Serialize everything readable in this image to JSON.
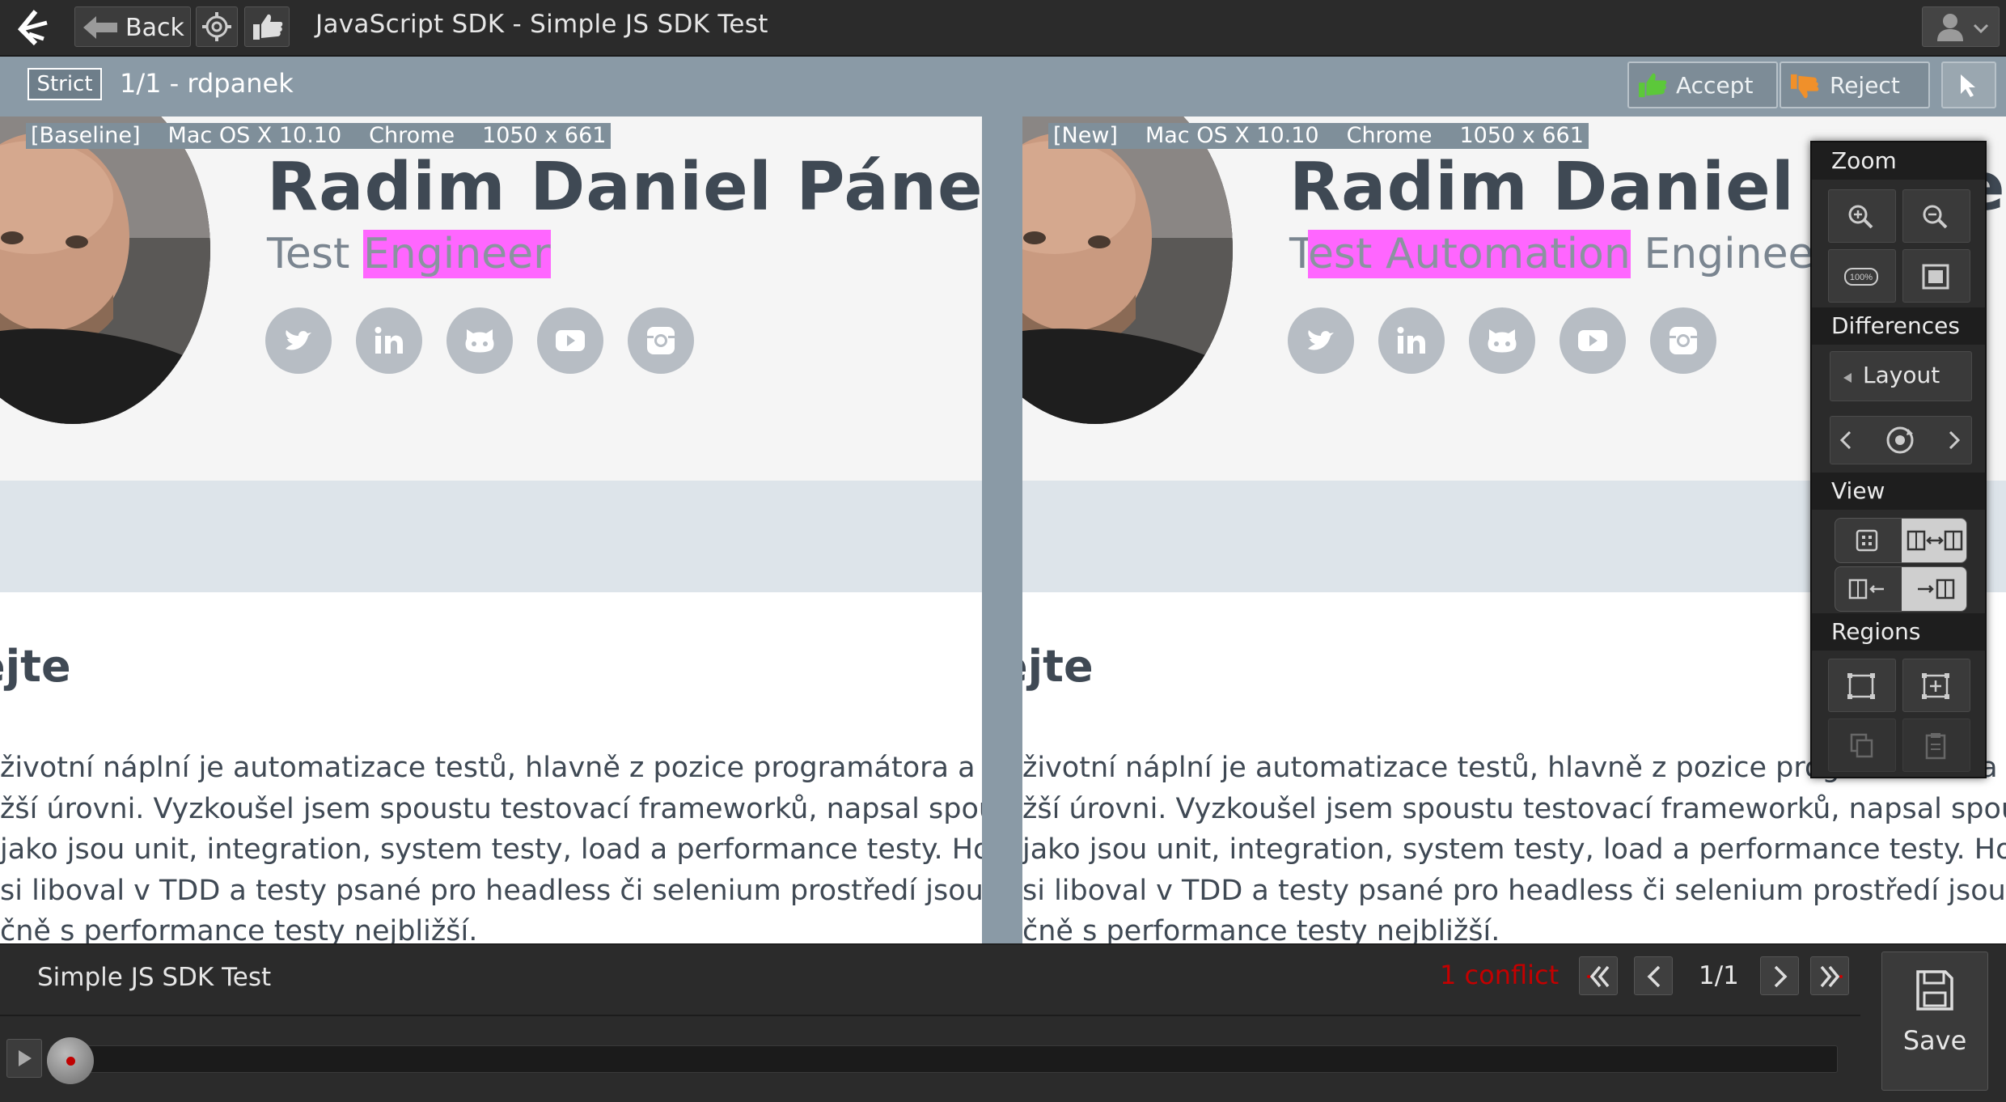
{
  "topbar": {
    "back_label": "Back",
    "title": "JavaScript SDK - Simple JS SDK Test",
    "icons": [
      "applitools-logo-icon",
      "back-arrow-icon",
      "gear-icon",
      "thumbs-up-icon",
      "user-icon",
      "chevron-down-icon"
    ]
  },
  "subbar": {
    "strict_label": "Strict",
    "step_info": "1/1  -  rdpanek",
    "accept_label": "Accept",
    "reject_label": "Reject"
  },
  "baseline": {
    "tag": "[Baseline]",
    "os": "Mac OS X 10.10",
    "browser": "Chrome",
    "viewport": "1050 x 661",
    "name": "Radim Daniel Pánek",
    "role_before": "Test ",
    "role_highlight": "Engineer",
    "role_after": "",
    "heading": "ejte",
    "paragraph": [
      "životní náplní je automatizace testů, hlavně z pozice programátora a na té",
      "žší úrovni. Vyzkoušel jsem spoustu testovací frameworků, napsal spoustu",
      " jako jsou unit, integration, system testy, load a performance testy. Hodně",
      "si liboval v TDD a testy psané pro headless či selenium prostředí jsou mi",
      "čně s performance testy nejbližší."
    ]
  },
  "current": {
    "tag": "[New]",
    "os": "Mac OS X 10.10",
    "browser": "Chrome",
    "viewport": "1050 x 661",
    "name": "Radim Daniel Pánek",
    "role_before": "T",
    "role_highlight": "est Automation",
    "role_after": " Engineer",
    "heading": "ejte",
    "paragraph": [
      "životní náplní je automatizace testů, hlavně z pozice programátora a na té",
      "žší úrovni. Vyzkoušel jsem spoustu testovací frameworků, napsal spoustu",
      " jako jsou unit, integration, system testy, load a performance testy. Hodně",
      "si liboval v TDD a testy psané pro headless či selenium prostředí jsou mi",
      "čně s performance testy nejbližší."
    ]
  },
  "social_icons": [
    "twitter-icon",
    "linkedin-icon",
    "github-icon",
    "youtube-icon",
    "instagram-icon"
  ],
  "panel": {
    "zoom_label": "Zoom",
    "zoom_100_label": "100%",
    "differences_label": "Differences",
    "layout_label": "Layout",
    "view_label": "View",
    "regions_label": "Regions"
  },
  "bottombar": {
    "test_name": "Simple JS SDK Test",
    "conflict_text": "1 conflict",
    "page_info": "1/1",
    "save_label": "Save"
  },
  "colors": {
    "highlight": "#ff66ff",
    "conflict": "#c40000",
    "accept_icon": "#5cc83a",
    "reject_icon": "#f0902a"
  }
}
